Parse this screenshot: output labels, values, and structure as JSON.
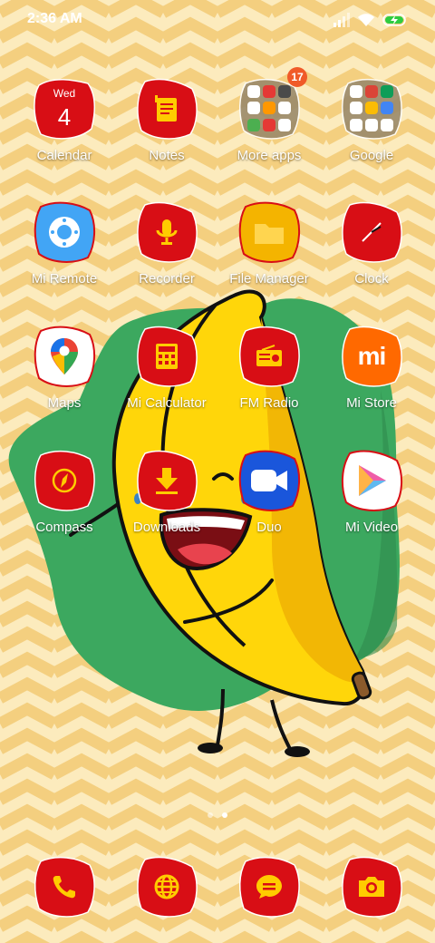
{
  "status_bar": {
    "time": "2:36 AM",
    "icons": [
      "signal-icon",
      "wifi-icon",
      "battery-charging-icon"
    ]
  },
  "colors": {
    "blob_red": "#d80e15",
    "blob_edge": "#ffffff",
    "wallpaper_light": "#fcebbd",
    "wallpaper_zigzag": "#f4cf7f",
    "banana_yellow": "#ffd60a",
    "leaf_green": "#3ca85f"
  },
  "apps": [
    {
      "id": "calendar",
      "label": "Calendar",
      "icon": "calendar-icon",
      "day": "Wed",
      "date": "4"
    },
    {
      "id": "notes",
      "label": "Notes",
      "icon": "notes-icon"
    },
    {
      "id": "more-apps",
      "label": "More apps",
      "icon": "folder-icon",
      "badge": "17"
    },
    {
      "id": "google",
      "label": "Google",
      "icon": "folder-icon"
    },
    {
      "id": "mi-remote",
      "label": "Mi Remote",
      "icon": "remote-icon"
    },
    {
      "id": "recorder",
      "label": "Recorder",
      "icon": "microphone-icon"
    },
    {
      "id": "file-manager",
      "label": "File Manager",
      "icon": "folder-icon"
    },
    {
      "id": "clock",
      "label": "Clock",
      "icon": "clock-icon"
    },
    {
      "id": "maps",
      "label": "Maps",
      "icon": "map-pin-icon"
    },
    {
      "id": "mi-calculator",
      "label": "Mi Calculator",
      "icon": "calculator-icon"
    },
    {
      "id": "fm-radio",
      "label": "FM Radio",
      "icon": "radio-icon"
    },
    {
      "id": "mi-store",
      "label": "Mi Store",
      "icon": "mi-logo-icon",
      "logo_text": "mi"
    },
    {
      "id": "compass",
      "label": "Compass",
      "icon": "compass-icon"
    },
    {
      "id": "downloads",
      "label": "Downloads",
      "icon": "download-icon"
    },
    {
      "id": "duo",
      "label": "Duo",
      "icon": "video-camera-icon"
    },
    {
      "id": "mi-video",
      "label": "Mi Video",
      "icon": "play-icon"
    }
  ],
  "dock": [
    {
      "id": "phone",
      "icon": "phone-icon"
    },
    {
      "id": "browser",
      "icon": "globe-icon"
    },
    {
      "id": "messages",
      "icon": "message-icon"
    },
    {
      "id": "camera",
      "icon": "camera-icon"
    }
  ],
  "page_indicator": {
    "pages": 2,
    "current": 2
  }
}
